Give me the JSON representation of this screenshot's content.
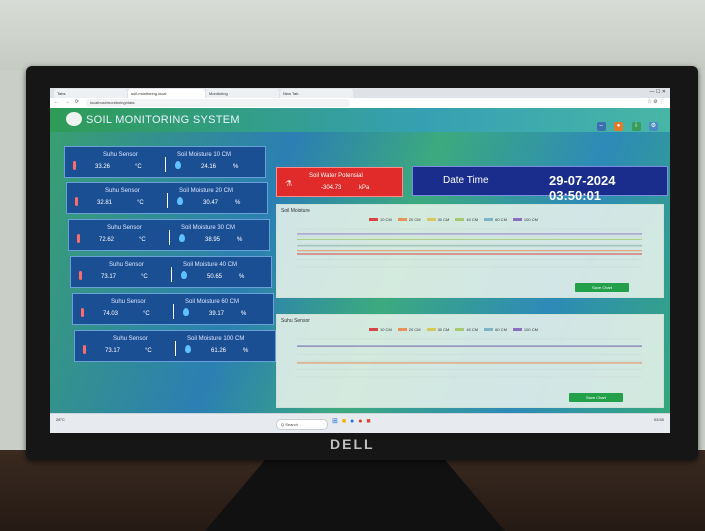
{
  "browser": {
    "tabs": [
      "Tabs",
      "soil-monitoring.local",
      "Monitoring",
      "New Tab"
    ],
    "url": "localhost/monitoring/data"
  },
  "app": {
    "title": "SOIL MONITORING SYSTEM"
  },
  "sensors": [
    {
      "temp_label": "Suhu Sensor",
      "temp_value": "33.26",
      "temp_unit": "°C",
      "moist_label": "Soil Moisture 10 CM",
      "moist_value": "24.16",
      "moist_unit": "%"
    },
    {
      "temp_label": "Suhu Sensor",
      "temp_value": "32.81",
      "temp_unit": "°C",
      "moist_label": "Soil Moisture 20 CM",
      "moist_value": "30.47",
      "moist_unit": "%"
    },
    {
      "temp_label": "Suhu Sensor",
      "temp_value": "72.62",
      "temp_unit": "°C",
      "moist_label": "Soil Moisture 30 CM",
      "moist_value": "38.95",
      "moist_unit": "%"
    },
    {
      "temp_label": "Suhu Sensor",
      "temp_value": "73.17",
      "temp_unit": "°C",
      "moist_label": "Soil Moisture 40 CM",
      "moist_value": "50.65",
      "moist_unit": "%"
    },
    {
      "temp_label": "Suhu Sensor",
      "temp_value": "74.03",
      "temp_unit": "°C",
      "moist_label": "Soil Moisture 60 CM",
      "moist_value": "39.17",
      "moist_unit": "%"
    },
    {
      "temp_label": "Suhu Sensor",
      "temp_value": "73.17",
      "temp_unit": "°C",
      "moist_label": "Soil Moisture 100 CM",
      "moist_value": "61.26",
      "moist_unit": "%"
    }
  ],
  "soil_water": {
    "label": "Soil Water Potensial",
    "value": "-304.73",
    "unit": "kPa"
  },
  "datetime": {
    "label": "Date Time",
    "value": "29-07-2024 03:50:01"
  },
  "charts": {
    "moisture": {
      "title": "Soil Moisture",
      "button": "Save Chart"
    },
    "temperature": {
      "title": "Suhu Sensor",
      "button": "Save Chart"
    }
  },
  "taskbar": {
    "search": "Q Search",
    "weather": "28°C",
    "clock": "03:50"
  },
  "colors": {
    "sensor_card": "#1b4f94",
    "soil_water": "#e12a2a",
    "datetime": "#1a2d8c",
    "save_button": "#23a04a"
  },
  "chart_data": [
    {
      "type": "line",
      "title": "Soil Moisture",
      "series": [
        {
          "name": "10 CM",
          "color": "#d94545",
          "values": [
            24,
            24,
            24,
            24,
            24,
            24,
            24,
            24,
            24,
            24
          ]
        },
        {
          "name": "20 CM",
          "color": "#e8915a",
          "values": [
            30,
            30,
            30,
            30,
            30,
            30,
            30,
            30,
            30,
            30
          ]
        },
        {
          "name": "30 CM",
          "color": "#d6c85a",
          "values": [
            39,
            39,
            39,
            39,
            39,
            39,
            39,
            39,
            39,
            39
          ]
        },
        {
          "name": "40 CM",
          "color": "#a8c870",
          "values": [
            51,
            51,
            51,
            51,
            51,
            51,
            51,
            51,
            51,
            51
          ]
        },
        {
          "name": "60 CM",
          "color": "#7fb3c9",
          "values": [
            39,
            39,
            39,
            39,
            39,
            39,
            39,
            39,
            39,
            39
          ]
        },
        {
          "name": "100 CM",
          "color": "#8a6fc1",
          "values": [
            61,
            61,
            61,
            61,
            61,
            61,
            61,
            61,
            61,
            61
          ]
        }
      ],
      "ylim": [
        0,
        70
      ],
      "grid": true,
      "legend": "top"
    },
    {
      "type": "line",
      "title": "Suhu Sensor",
      "series": [
        {
          "name": "10 CM",
          "color": "#d94545",
          "values": [
            33,
            33,
            33,
            33,
            33,
            33,
            33,
            33,
            33,
            33
          ]
        },
        {
          "name": "20 CM",
          "color": "#e8915a",
          "values": [
            33,
            33,
            33,
            33,
            33,
            33,
            33,
            33,
            33,
            33
          ]
        },
        {
          "name": "30 CM",
          "color": "#d6c85a",
          "values": [
            73,
            73,
            73,
            73,
            73,
            73,
            73,
            73,
            73,
            73
          ]
        },
        {
          "name": "40 CM",
          "color": "#a8c870",
          "values": [
            73,
            73,
            73,
            73,
            73,
            73,
            73,
            73,
            73,
            73
          ]
        },
        {
          "name": "60 CM",
          "color": "#7fb3c9",
          "values": [
            74,
            74,
            74,
            74,
            74,
            74,
            74,
            74,
            74,
            74
          ]
        },
        {
          "name": "100 CM",
          "color": "#8a6fc1",
          "values": [
            73,
            73,
            73,
            73,
            73,
            73,
            73,
            73,
            73,
            73
          ]
        }
      ],
      "ylim": [
        0,
        90
      ],
      "grid": true,
      "legend": "top"
    }
  ]
}
